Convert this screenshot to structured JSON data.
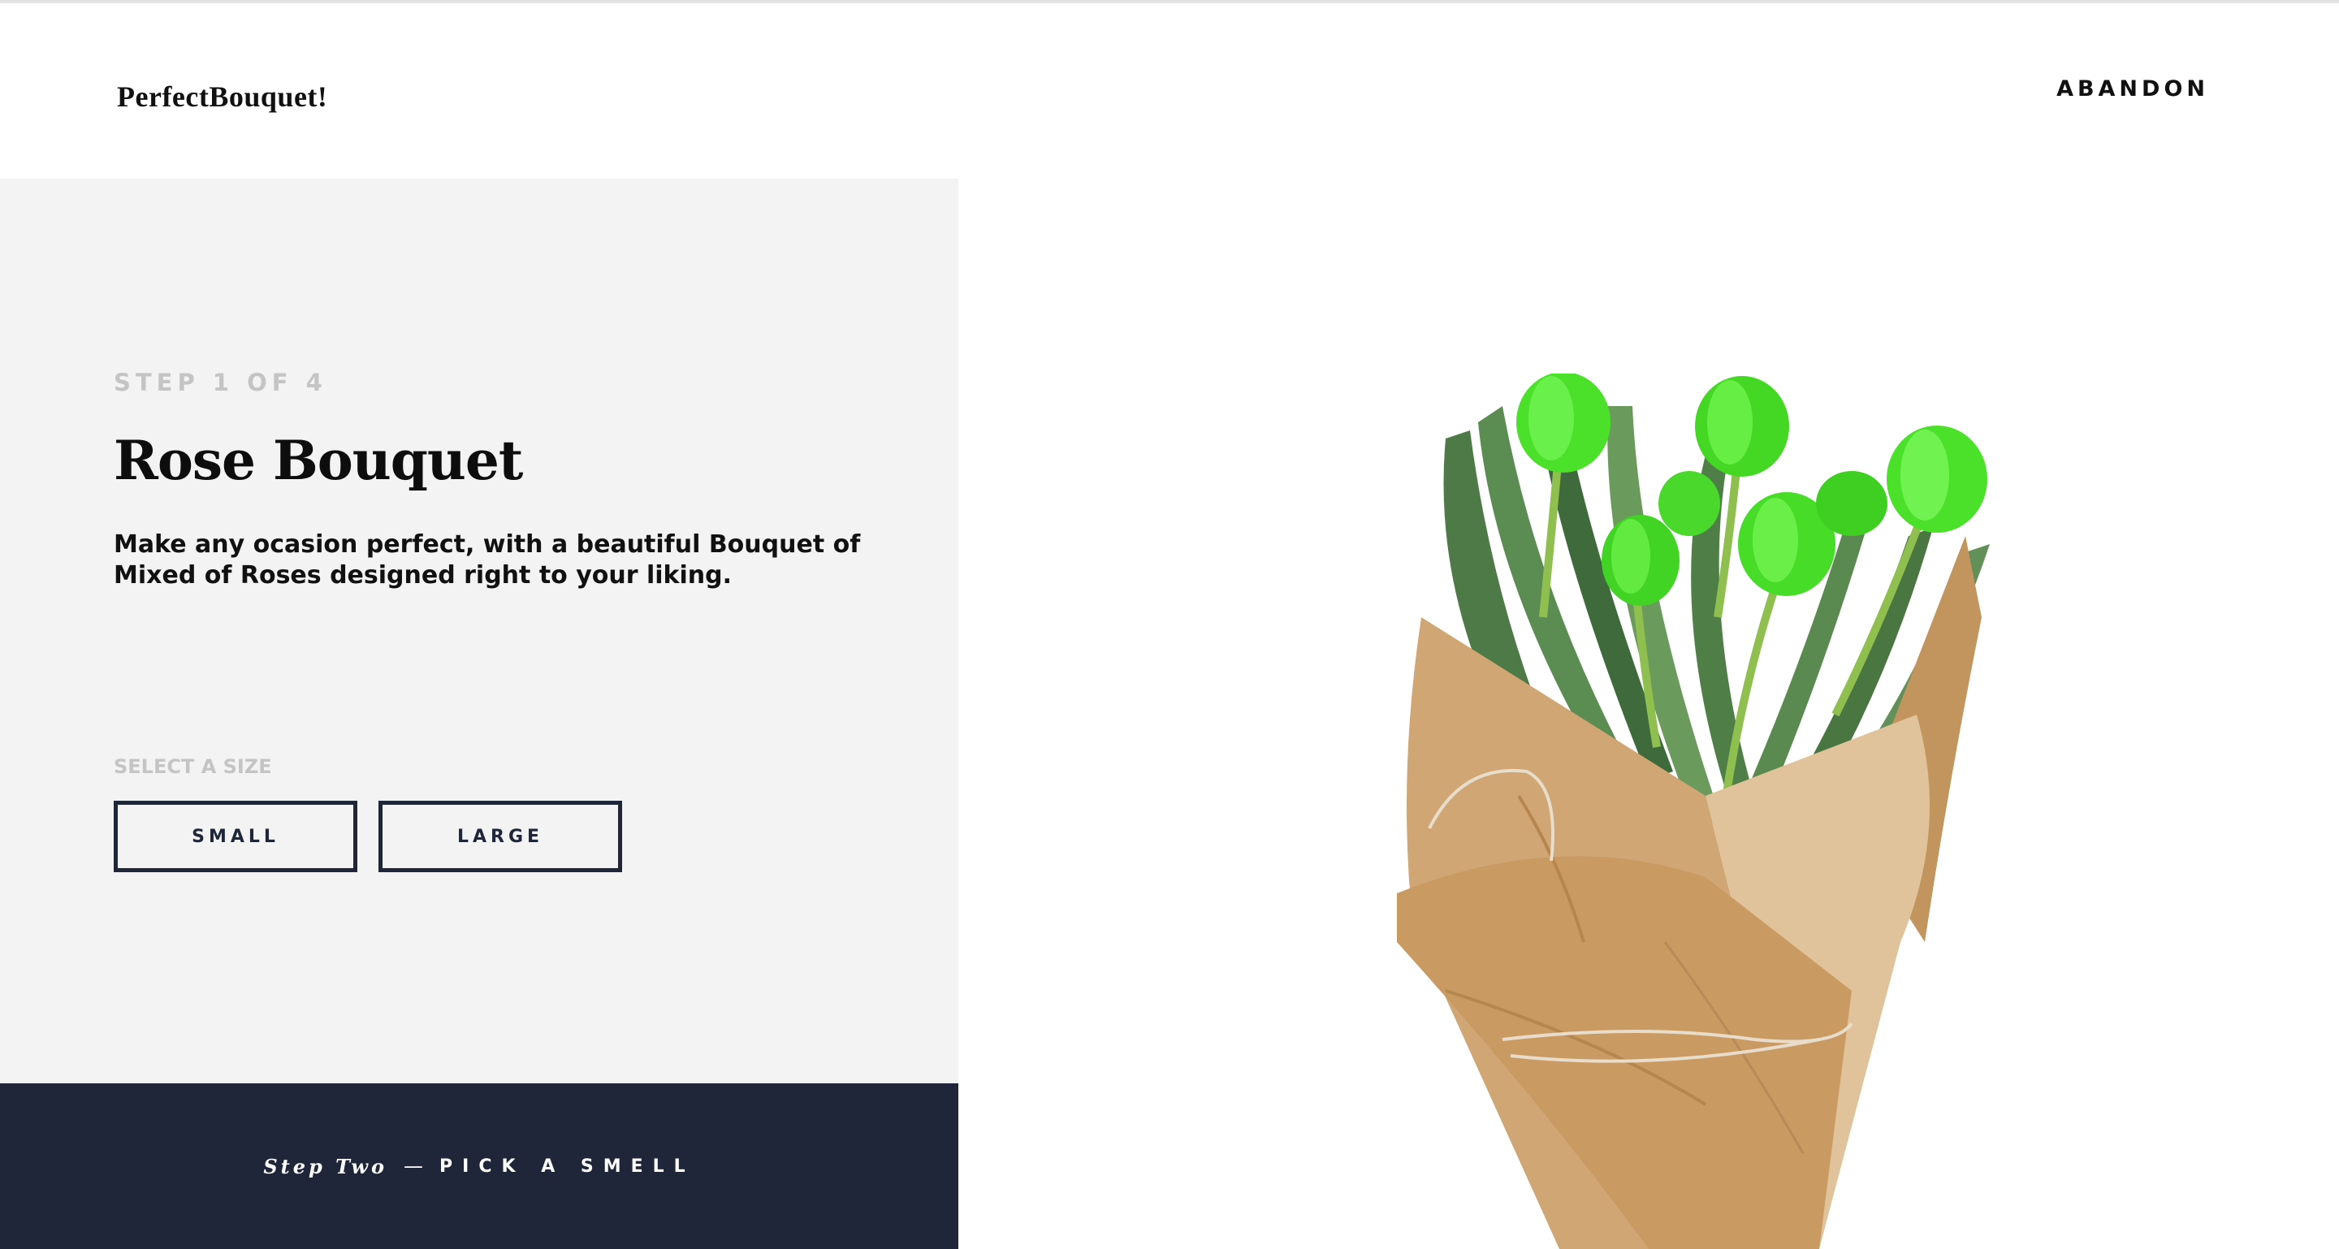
{
  "header": {
    "logo": "PerfectBouquet!",
    "abandon_label": "ABANDON"
  },
  "step": {
    "indicator": "STEP 1 OF 4",
    "title": "Rose Bouquet",
    "description": "Make any ocasion perfect, with a beautiful Bouquet of Mixed of Roses designed right to your liking."
  },
  "size_selector": {
    "label": "SELECT A SIZE",
    "options": [
      "SMALL",
      "LARGE"
    ]
  },
  "next_step": {
    "prefix": "Step Two",
    "separator": "—",
    "action": "PICK A SMELL"
  },
  "image": {
    "subject": "bouquet of green tulips wrapped in brown kraft paper",
    "icon": "bouquet-image"
  },
  "colors": {
    "panel_background": "#f3f3f3",
    "navy": "#1f2639",
    "muted_text": "#c4c4c4",
    "tulip_green": "#4be02a",
    "paper_brown": "#d0a774"
  }
}
